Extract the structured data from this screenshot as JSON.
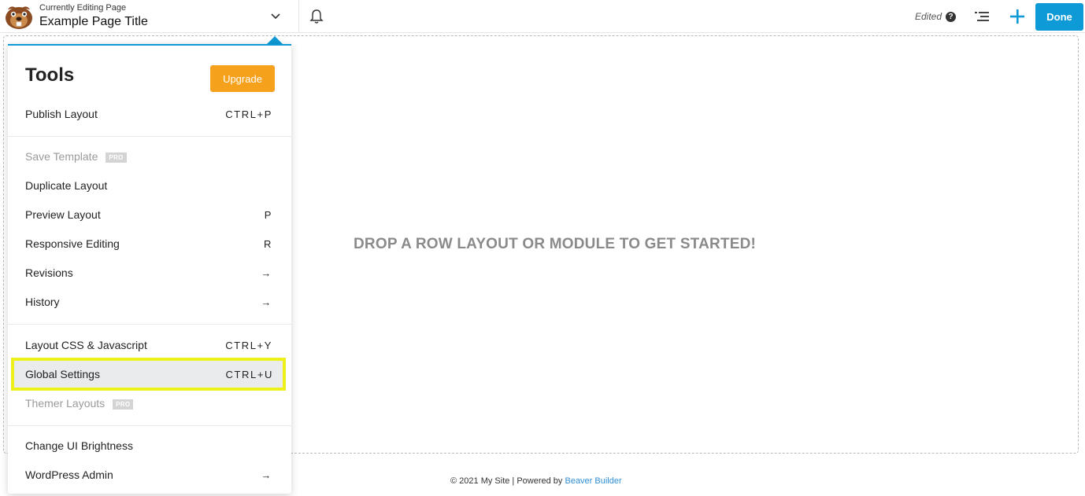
{
  "header": {
    "subtitle": "Currently Editing Page",
    "page_title": "Example Page Title",
    "status": "Edited",
    "help_glyph": "?",
    "done_label": "Done",
    "icons": [
      "beaver-logo-icon",
      "chevron-down-icon",
      "bell-icon",
      "help-icon",
      "outline-list-icon",
      "plus-icon"
    ],
    "accent_color": "#0e9ad6"
  },
  "canvas": {
    "drop_message": "DROP A ROW LAYOUT OR MODULE TO GET STARTED!"
  },
  "footer": {
    "text": "© 2021 My Site | Powered by ",
    "link": "Beaver Builder"
  },
  "tools_panel": {
    "title": "Tools",
    "upgrade_label": "Upgrade",
    "upgrade_color": "#f5a11c",
    "items": [
      {
        "label": "Publish Layout",
        "shortcut": "CTRL+P"
      },
      {
        "label": "Save Template",
        "badge": "PRO"
      },
      {
        "label": "Duplicate Layout",
        "shortcut": ""
      },
      {
        "label": "Preview Layout",
        "shortcut": "P"
      },
      {
        "label": "Responsive Editing",
        "shortcut": "R"
      },
      {
        "label": "Revisions",
        "shortcut": "→"
      },
      {
        "label": "History",
        "shortcut": "→"
      },
      {
        "label": "Layout CSS & Javascript",
        "shortcut": "CTRL+Y"
      },
      {
        "label": "Global Settings",
        "shortcut": "CTRL+U"
      },
      {
        "label": "Themer Layouts",
        "badge": "PRO"
      },
      {
        "label": "Change UI Brightness",
        "shortcut": ""
      },
      {
        "label": "WordPress Admin",
        "shortcut": "→"
      }
    ],
    "highlight_color": "#eef01a"
  }
}
